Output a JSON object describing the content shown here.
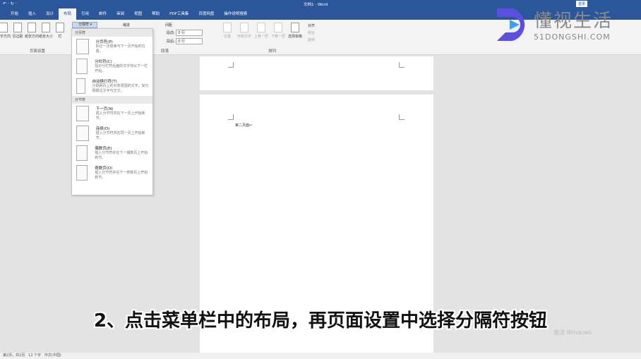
{
  "titlebar": {
    "quick_access": "↶ · ↻ ·",
    "title": "文档1 - Word",
    "login": "登录"
  },
  "tabs": [
    "开始",
    "插入",
    "设计",
    "布局",
    "引用",
    "邮件",
    "审阅",
    "视图",
    "帮助",
    "PDF工具集",
    "百度网盘",
    "操作说明搜索"
  ],
  "active_tab": "布局",
  "ribbon": {
    "page_setup": {
      "label": "页面设置",
      "buttons": [
        "文字方向",
        "页边距",
        "纸张方向",
        "纸张大小",
        "栏"
      ]
    },
    "breaks_button": "分隔符",
    "indent_label": "缩进",
    "spacing": {
      "label": "间距",
      "before_label": "段前:",
      "before_value": "0 行",
      "after_label": "段后:",
      "after_value": "0 行"
    },
    "paragraph_label": "段落",
    "arrange": {
      "label": "排列",
      "buttons": [
        "位置",
        "环绕文字",
        "上移一层",
        "下移一层",
        "选择窗格"
      ],
      "align": "对齐",
      "group": "组合",
      "rotate": "旋转"
    }
  },
  "menu": {
    "sections": [
      {
        "title": "分页符",
        "items": [
          {
            "name": "分页符(P)",
            "desc": "标记一页结束与下一页开始的位置。"
          },
          {
            "name": "分栏符(C)",
            "desc": "指示分栏符后面的文字将从下一栏开始。"
          },
          {
            "name": "自动换行符(T)",
            "desc": "分隔网页上的对象周围的文字，如分隔题注文字与正文。"
          }
        ]
      },
      {
        "title": "分节符",
        "items": [
          {
            "name": "下一页(N)",
            "desc": "插入分节符并在下一页上开始新节。"
          },
          {
            "name": "连续(O)",
            "desc": "插入分节符并在同一页上开始新节。"
          },
          {
            "name": "偶数页(E)",
            "desc": "插入分节符并在下一偶数页上开始新节。"
          },
          {
            "name": "奇数页(D)",
            "desc": "插入分节符并在下一奇数页上开始新节。"
          }
        ]
      }
    ]
  },
  "document": {
    "page2_text": "第二页面↵"
  },
  "subtitle": "2、点击菜单栏中的布局，再页面设置中选择分隔符按钮",
  "watermark": {
    "logo_cn": "懂视生活",
    "logo_en": "51DONGSHI.COM",
    "activate": "激活 Windows"
  },
  "status": {
    "page": "第2页，共2页",
    "words": "12 个字",
    "lang": "中文(中国)"
  },
  "colors": {
    "brand": "#2b579a",
    "logo": "#5b4fe0"
  }
}
